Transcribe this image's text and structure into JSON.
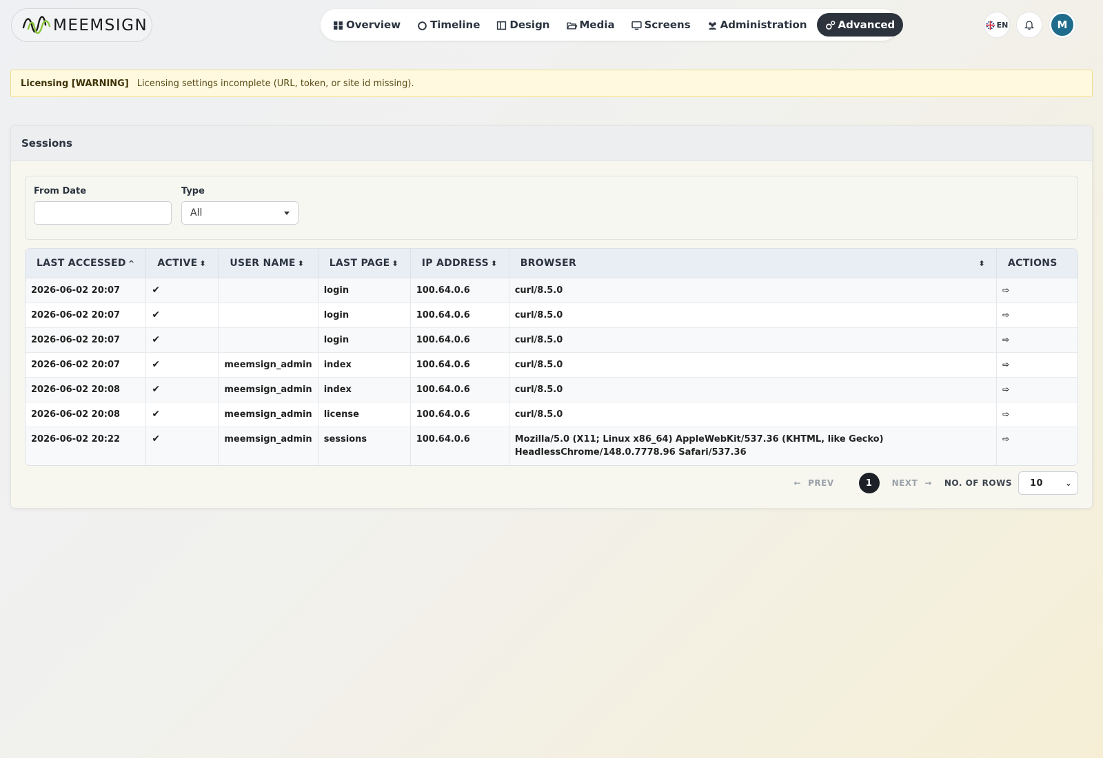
{
  "brand": {
    "name": "MEEMSIGN",
    "accent": "#2c333c"
  },
  "nav": [
    {
      "label": "Overview",
      "icon": "grid-icon",
      "active": false
    },
    {
      "label": "Timeline",
      "icon": "circle-icon",
      "active": false
    },
    {
      "label": "Design",
      "icon": "layout-icon",
      "active": false
    },
    {
      "label": "Media",
      "icon": "folder-icon",
      "active": false
    },
    {
      "label": "Screens",
      "icon": "monitor-icon",
      "active": false
    },
    {
      "label": "Administration",
      "icon": "users-icon",
      "active": false
    },
    {
      "label": "Advanced",
      "icon": "gears-icon",
      "active": true
    }
  ],
  "header": {
    "language": "EN",
    "avatar_initial": "M"
  },
  "alert": {
    "title": "Licensing [WARNING]",
    "message": "Licensing settings incomplete (URL, token, or site id missing)."
  },
  "card": {
    "title": "Sessions"
  },
  "filters": {
    "from_date_label": "From Date",
    "from_date_value": "",
    "type_label": "Type",
    "type_value": "All"
  },
  "table": {
    "columns": [
      "LAST ACCESSED",
      "ACTIVE",
      "USER NAME",
      "LAST PAGE",
      "IP ADDRESS",
      "BROWSER",
      "ACTIONS"
    ],
    "sort_column": "LAST ACCESSED",
    "rows": [
      {
        "last_accessed": "2026-06-02 20:07",
        "active": "✔",
        "user": "",
        "page": "login",
        "ip": "100.64.0.6",
        "browser": "curl/8.5.0"
      },
      {
        "last_accessed": "2026-06-02 20:07",
        "active": "✔",
        "user": "",
        "page": "login",
        "ip": "100.64.0.6",
        "browser": "curl/8.5.0"
      },
      {
        "last_accessed": "2026-06-02 20:07",
        "active": "✔",
        "user": "",
        "page": "login",
        "ip": "100.64.0.6",
        "browser": "curl/8.5.0"
      },
      {
        "last_accessed": "2026-06-02 20:07",
        "active": "✔",
        "user": "meemsign_admin",
        "page": "index",
        "ip": "100.64.0.6",
        "browser": "curl/8.5.0"
      },
      {
        "last_accessed": "2026-06-02 20:08",
        "active": "✔",
        "user": "meemsign_admin",
        "page": "index",
        "ip": "100.64.0.6",
        "browser": "curl/8.5.0"
      },
      {
        "last_accessed": "2026-06-02 20:08",
        "active": "✔",
        "user": "meemsign_admin",
        "page": "license",
        "ip": "100.64.0.6",
        "browser": "curl/8.5.0"
      },
      {
        "last_accessed": "2026-06-02 20:22",
        "active": "✔",
        "user": "meemsign_admin",
        "page": "sessions",
        "ip": "100.64.0.6",
        "browser": "Mozilla/5.0 (X11; Linux x86_64) AppleWebKit/537.36 (KHTML, like Gecko) HeadlessChrome/148.0.7778.96 Safari/537.36"
      }
    ]
  },
  "pagination": {
    "prev_label": "PREV",
    "next_label": "NEXT",
    "current_page": "1",
    "rows_label": "NO. OF ROWS",
    "rows_value": "10"
  }
}
